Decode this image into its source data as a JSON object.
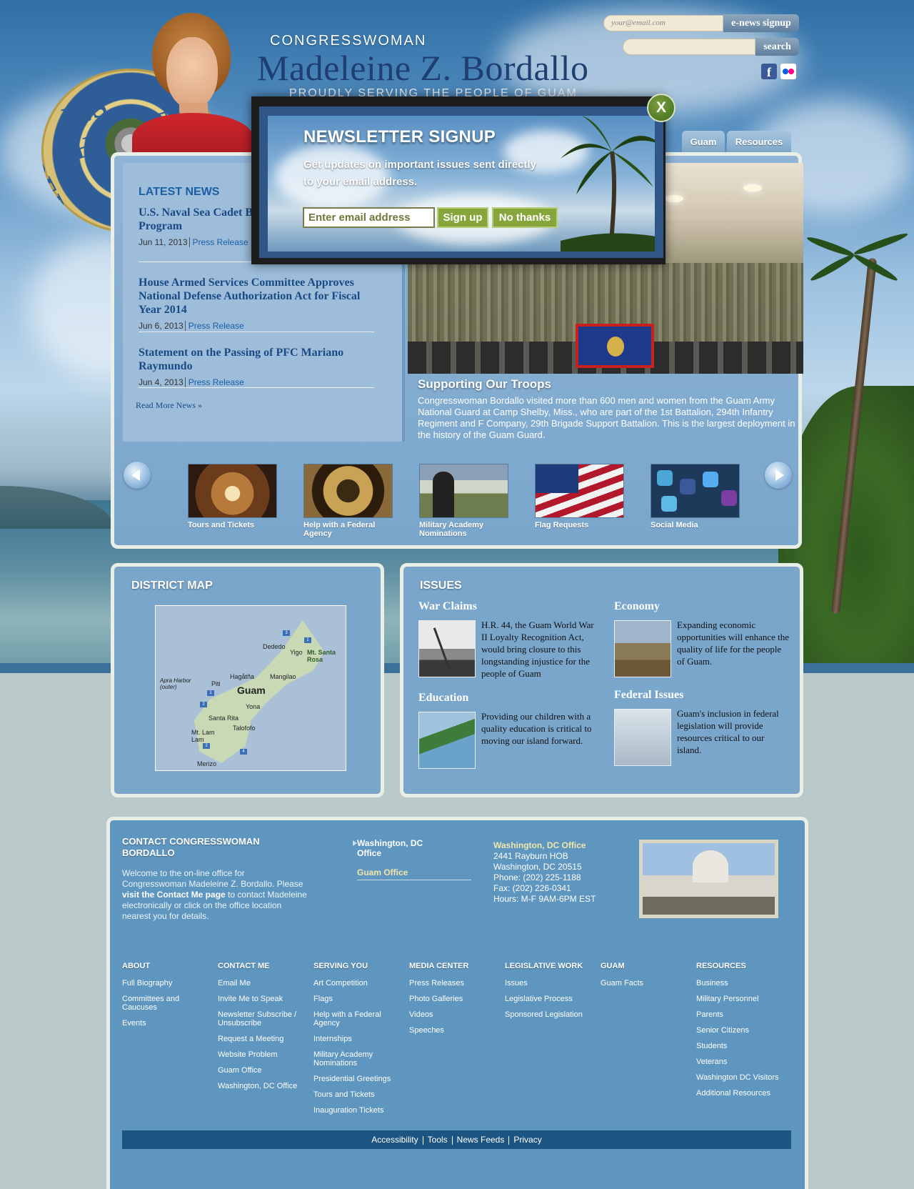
{
  "header": {
    "congresswoman_label": "CONGRESSWOMAN",
    "name": "Madeleine Z. Bordallo",
    "tagline": "PROUDLY SERVING THE PEOPLE OF GUAM",
    "seal_text_top": "U.S. HOUSE",
    "seal_text_bottom": "REPRESE"
  },
  "tools": {
    "enews_placeholder": "your@email.com",
    "enews_button": "e-news signup",
    "search_placeholder": "",
    "search_button": "search",
    "social": [
      "facebook-icon",
      "flickr-icon"
    ]
  },
  "nav": {
    "tabs": [
      {
        "label": "Guam"
      },
      {
        "label": "Resources"
      }
    ]
  },
  "news": {
    "heading": "LATEST NEWS",
    "items": [
      {
        "title": "U.S. Naval Sea Cadet Bordallo for Support Program",
        "date": "Jun 11, 2013",
        "type": "Press Release"
      },
      {
        "title": "House Armed Services Committee Approves National Defense Authorization Act for Fiscal Year 2014",
        "date": "Jun 6, 2013",
        "type": "Press Release"
      },
      {
        "title": "Statement on the Passing of PFC Mariano Raymundo",
        "date": "Jun 4, 2013",
        "type": "Press Release"
      }
    ],
    "read_more": "Read More News »"
  },
  "feature": {
    "title": "Supporting Our Troops",
    "text": "Congresswoman Bordallo visited more than 600 men and women from the Guam Army National Guard at Camp Shelby, Miss., who are part of the 1st Battalion, 294th Infantry Regiment and F Company, 29th Brigade Support Battalion. This is the largest deployment in the history of the Guam Guard."
  },
  "carousel": {
    "items": [
      {
        "label": "Tours and Tickets"
      },
      {
        "label": "Help with a Federal Agency"
      },
      {
        "label": "Military Academy Nominations"
      },
      {
        "label": "Flag Requests"
      },
      {
        "label": "Social Media"
      }
    ]
  },
  "district_map": {
    "heading": "DISTRICT MAP",
    "labels": {
      "dededo": "Dededo",
      "yigo": "Yigo",
      "mt_santa_rosa": "Mt. Santa Rosa",
      "hagatna": "Hagåtña",
      "mangilao": "Mangilao",
      "apra_harbor": "Apra Harbor (outer)",
      "piti": "Piti",
      "guam": "Guam",
      "yona": "Yona",
      "santa_rita": "Santa Rita",
      "talofofo": "Talofofo",
      "mt_lam_lam": "Mt. Lam Lam",
      "merizo": "Merizo"
    },
    "pins": [
      "3",
      "1",
      "1",
      "2",
      "2",
      "4"
    ]
  },
  "issues": {
    "heading": "ISSUES",
    "items": [
      {
        "title": "War Claims",
        "text": "H.R. 44, the Guam World War II Loyalty Recognition Act, would bring closure to this longstanding injustice for the people of Guam"
      },
      {
        "title": "Economy",
        "text": "Expanding economic opportunities will enhance the quality of life for the people of Guam."
      },
      {
        "title": "Education",
        "text": "Providing our children with a quality education is critical to moving our island forward."
      },
      {
        "title": "Federal Issues",
        "text": "Guam's inclusion in federal legislation will provide resources critical to our island."
      }
    ]
  },
  "footer": {
    "heading": "CONTACT CONGRESSWOMAN BORDALLO",
    "intro_1": "Welcome to the on-line office for Congresswoman Madeleine Z. Bordallo. Please",
    "intro_link": "visit the Contact Me page",
    "intro_2": "to contact Madeleine electronically or click on the office location nearest you for details.",
    "offices": [
      "Washington, DC Office",
      "Guam Office"
    ],
    "address": {
      "title": "Washington, DC Office",
      "line1": "2441 Rayburn HOB",
      "line2": "Washington, DC 20515",
      "phone": "Phone: (202) 225-1188",
      "fax": "Fax: (202) 226-0341",
      "hours": "Hours: M-F 9AM-6PM EST"
    },
    "columns": [
      {
        "head": "ABOUT",
        "links": [
          "Full Biography",
          "Committees and Caucuses",
          "Events"
        ]
      },
      {
        "head": "CONTACT ME",
        "links": [
          "Email Me",
          "Invite Me to Speak",
          "Newsletter Subscribe / Unsubscribe",
          "Request a Meeting",
          "Website Problem",
          "Guam Office",
          "Washington, DC Office"
        ]
      },
      {
        "head": "SERVING YOU",
        "links": [
          "Art Competition",
          "Flags",
          "Help with a Federal Agency",
          "Internships",
          "Military Academy Nominations",
          "Presidential Greetings",
          "Tours and Tickets",
          "Inauguration Tickets"
        ]
      },
      {
        "head": "MEDIA CENTER",
        "links": [
          "Press Releases",
          "Photo Galleries",
          "Videos",
          "Speeches"
        ]
      },
      {
        "head": "LEGISLATIVE WORK",
        "links": [
          "Issues",
          "Legislative Process",
          "Sponsored Legislation"
        ]
      },
      {
        "head": "GUAM",
        "links": [
          "Guam Facts"
        ]
      },
      {
        "head": "RESOURCES",
        "links": [
          "Business",
          "Military Personnel",
          "Parents",
          "Senior Citizens",
          "Students",
          "Veterans",
          "Washington DC Visitors",
          "Additional Resources"
        ]
      }
    ],
    "bar_links": [
      "Accessibility",
      "Tools",
      "News Feeds",
      "Privacy"
    ]
  },
  "modal": {
    "title": "NEWSLETTER SIGNUP",
    "text": "Get updates on important issues sent directly to your email address.",
    "email_placeholder": "Enter email address",
    "signup_button": "Sign up",
    "decline_button": "No thanks",
    "close_label": "X"
  }
}
